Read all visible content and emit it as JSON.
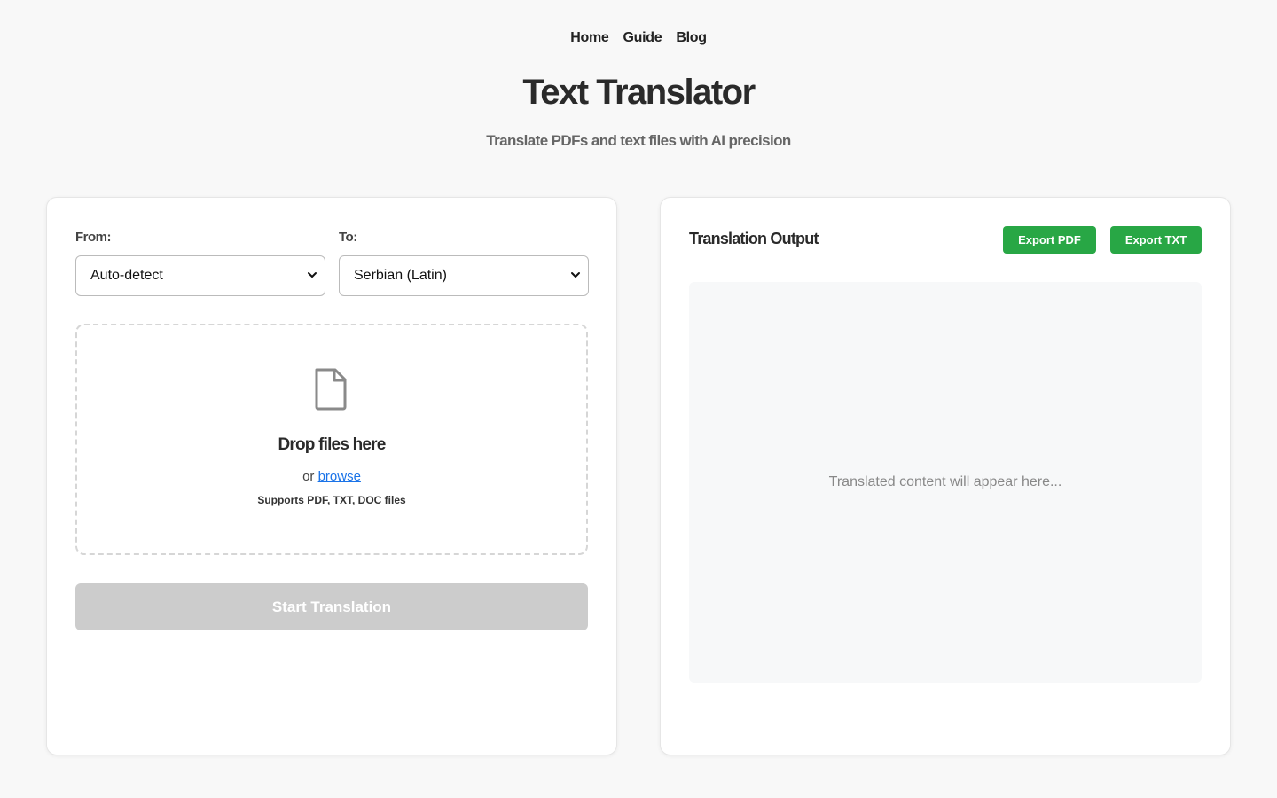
{
  "nav": {
    "items": [
      {
        "label": "Home"
      },
      {
        "label": "Guide"
      },
      {
        "label": "Blog"
      }
    ]
  },
  "header": {
    "title": "Text Translator",
    "subtitle": "Translate PDFs and text files with AI precision"
  },
  "input_panel": {
    "from_label": "From:",
    "from_value": "Auto-detect",
    "to_label": "To:",
    "to_value": "Serbian (Latin)",
    "dropzone": {
      "title": "Drop files here",
      "or_text": "or",
      "browse_label": "browse",
      "supports": "Supports PDF, TXT, DOC files"
    },
    "start_button": "Start Translation"
  },
  "output_panel": {
    "title": "Translation Output",
    "export_pdf": "Export PDF",
    "export_txt": "Export TXT",
    "placeholder": "Translated content will appear here..."
  },
  "colors": {
    "accent_green": "#28a745",
    "link_blue": "#1a73e8",
    "disabled_gray": "#cccccc"
  }
}
